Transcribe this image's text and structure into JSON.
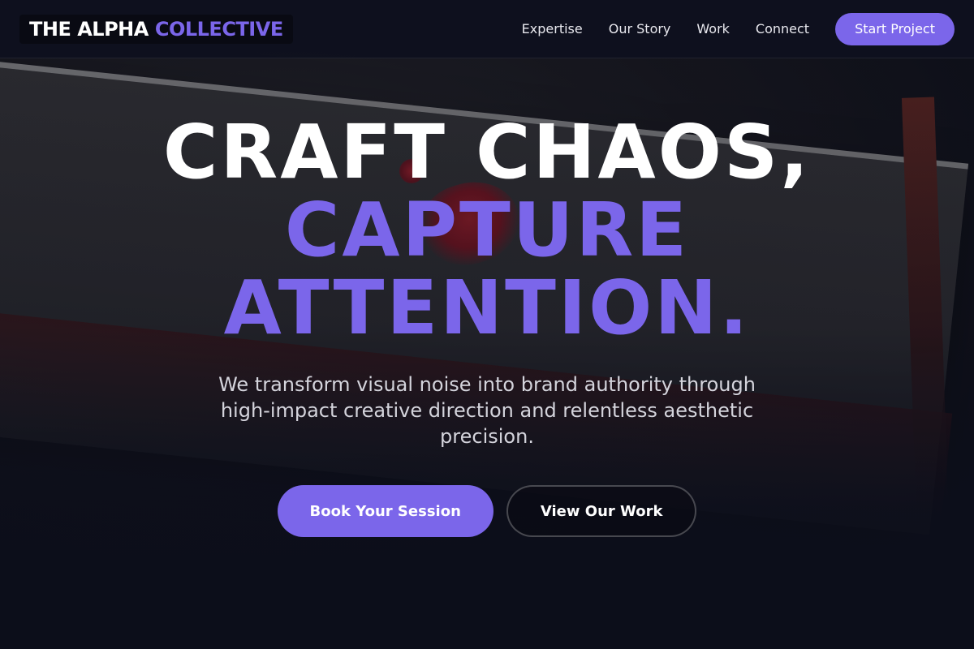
{
  "brand": {
    "name_main": "THE ALPHA",
    "name_accent": "COLLECTIVE"
  },
  "nav": {
    "links": [
      "Expertise",
      "Our Story",
      "Work",
      "Connect"
    ],
    "cta_label": "Start Project"
  },
  "hero": {
    "title_line_1": "CRAFT CHAOS,",
    "title_line_2": "CAPTURE",
    "title_line_3": "ATTENTION.",
    "subtitle": "We transform visual noise into brand authority through high-impact creative direction and relentless aesthetic precision.",
    "primary_button": "Book Your Session",
    "secondary_button": "View Our Work"
  },
  "colors": {
    "accent": "#7b66ea",
    "background": "#0d0f1a",
    "text": "#ffffff"
  }
}
